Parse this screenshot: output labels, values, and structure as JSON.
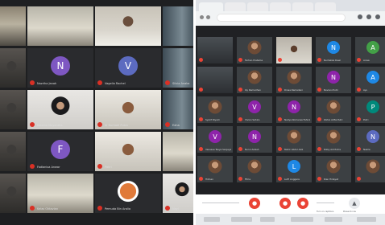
{
  "left_screen": {
    "tiles": [
      {
        "kind": "video",
        "style": "v-class",
        "name": ""
      },
      {
        "kind": "video",
        "style": "v-room",
        "name": ""
      },
      {
        "kind": "video",
        "style": "v-person",
        "name": ""
      },
      {
        "kind": "video",
        "style": "v-edge",
        "name": ""
      },
      {
        "kind": "video",
        "style": "v-dark",
        "name": ""
      },
      {
        "kind": "avatar",
        "letter": "N",
        "color": "#7e57c2",
        "name": "Nazriha Janah"
      },
      {
        "kind": "avatar",
        "letter": "V",
        "color": "#5c6bc0",
        "name": "Vagelia Rachel"
      },
      {
        "kind": "video",
        "style": "v-edge",
        "name": "Silvia Anaka"
      },
      {
        "kind": "video",
        "style": "v-dark",
        "name": ""
      },
      {
        "kind": "video",
        "style": "v-hijab",
        "name": "Kalamo Mayantha"
      },
      {
        "kind": "video",
        "style": "v-face",
        "name": "Al Nurhadi Putra"
      },
      {
        "kind": "video",
        "style": "v-edge",
        "name": "Edna"
      },
      {
        "kind": "video",
        "style": "v-dark",
        "name": ""
      },
      {
        "kind": "avatar",
        "letter": "F",
        "color": "#7e57c2",
        "name": "Fadlanisa Anwar"
      },
      {
        "kind": "video",
        "style": "v-face",
        "name": "Pakri"
      },
      {
        "kind": "video",
        "style": "v-room",
        "name": ""
      },
      {
        "kind": "video",
        "style": "v-dark",
        "name": ""
      },
      {
        "kind": "video",
        "style": "v-room",
        "name": "Kelas Oktavian"
      },
      {
        "kind": "video",
        "style": "v-pic",
        "name": "Pemuda Bin Aralia"
      },
      {
        "kind": "video",
        "style": "v-hijab",
        "name": "Nayl"
      }
    ]
  },
  "right_screen": {
    "tiles": [
      {
        "kind": "video",
        "name": ""
      },
      {
        "kind": "photo",
        "name": "Farhan Pratama"
      },
      {
        "kind": "bigvideo",
        "name": ""
      },
      {
        "kind": "avatar",
        "letter": "N",
        "color": "#1e88e5",
        "name": "Nurhaliza Dewi"
      },
      {
        "kind": "avatar",
        "letter": "A",
        "color": "#43a047",
        "name": "Anisa"
      },
      {
        "kind": "video",
        "name": ""
      },
      {
        "kind": "photo",
        "name": "Iky Ramadhan"
      },
      {
        "kind": "photo",
        "name": "Rinaa Ramadani"
      },
      {
        "kind": "avatar",
        "letter": "N",
        "color": "#8e24aa",
        "name": "Noviani Putri"
      },
      {
        "kind": "avatar",
        "letter": "A",
        "color": "#1e88e5",
        "name": "Ayu"
      },
      {
        "kind": "photo",
        "name": "Syarif Riyadi"
      },
      {
        "kind": "avatar",
        "letter": "V",
        "color": "#8e24aa",
        "name": "Vivian Sahira"
      },
      {
        "kind": "avatar",
        "letter": "N",
        "color": "#8e24aa",
        "name": "Nadya Romansa Fahrul"
      },
      {
        "kind": "photo",
        "name": "Zahra Alifia Putri"
      },
      {
        "kind": "avatar",
        "letter": "P",
        "color": "#00897b",
        "name": "Putri"
      },
      {
        "kind": "avatar",
        "letter": "V",
        "color": "#8e24aa",
        "name": "Vanessa Tasya Sanjaya"
      },
      {
        "kind": "avatar",
        "letter": "N",
        "color": "#8e24aa",
        "name": "Nurul Azizah"
      },
      {
        "kind": "photo",
        "name": "Mahir Abdul Aziz"
      },
      {
        "kind": "photo",
        "name": "Rizky Adi Putra"
      },
      {
        "kind": "avatar",
        "letter": "N",
        "color": "#5c6bc0",
        "name": "Nazila"
      },
      {
        "kind": "photo",
        "name": "Hilman"
      },
      {
        "kind": "photo",
        "name": "Fitria"
      },
      {
        "kind": "avatar",
        "letter": "L",
        "color": "#1e88e5",
        "name": "Lutfi Anggara"
      },
      {
        "kind": "photo",
        "name": "Rian Hidayat"
      },
      {
        "kind": "photo",
        "name": ""
      }
    ],
    "controls": {
      "present_label": "Present now",
      "captions_label": "Turn on captions"
    },
    "colors": {
      "end_call": "#ea4335",
      "mic_off": "#ea4335",
      "background": "#202124"
    }
  }
}
